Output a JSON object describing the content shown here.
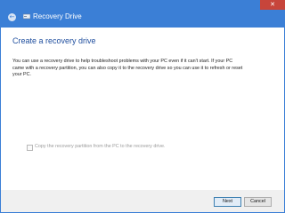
{
  "window": {
    "title": "Recovery Drive",
    "close_glyph": "✕",
    "back_glyph": "←"
  },
  "main": {
    "heading": "Create a recovery drive",
    "description": "You can use a recovery drive to help troubleshoot problems with your PC even if it can't start. If your PC came with a recovery partition, you can also copy it to the recovery drive so you can use it to refresh or reset your PC.",
    "checkbox_label": "Copy the recovery partition from the PC to the recovery drive.",
    "checkbox_checked": false,
    "checkbox_enabled": false
  },
  "footer": {
    "next_label": "Next",
    "cancel_label": "Cancel"
  },
  "colors": {
    "accent": "#3b7fd6",
    "heading": "#1f4e9e",
    "close": "#c7453b"
  },
  "icons": {
    "back": "back-arrow-icon",
    "app": "recovery-drive-icon",
    "close": "close-icon"
  }
}
